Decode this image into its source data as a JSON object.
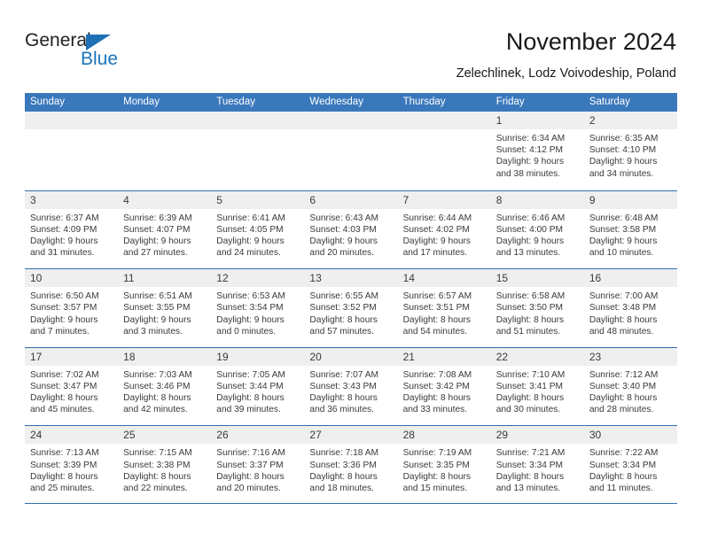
{
  "logo": {
    "word_one": "General",
    "word_two": "Blue",
    "triangle_color": "#1f6fb5",
    "blue_color": "#1b75bb"
  },
  "header": {
    "title": "November 2024",
    "location": "Zelechlinek, Lodz Voivodeship, Poland"
  },
  "colors": {
    "header_bar": "#3a78bc",
    "row_divider": "#2f6fb0",
    "daynum_band": "#efefef"
  },
  "weekdays": [
    "Sunday",
    "Monday",
    "Tuesday",
    "Wednesday",
    "Thursday",
    "Friday",
    "Saturday"
  ],
  "weeks": [
    [
      {
        "day": "",
        "sunrise": "",
        "sunset": "",
        "daylight1": "",
        "daylight2": ""
      },
      {
        "day": "",
        "sunrise": "",
        "sunset": "",
        "daylight1": "",
        "daylight2": ""
      },
      {
        "day": "",
        "sunrise": "",
        "sunset": "",
        "daylight1": "",
        "daylight2": ""
      },
      {
        "day": "",
        "sunrise": "",
        "sunset": "",
        "daylight1": "",
        "daylight2": ""
      },
      {
        "day": "",
        "sunrise": "",
        "sunset": "",
        "daylight1": "",
        "daylight2": ""
      },
      {
        "day": "1",
        "sunrise": "Sunrise: 6:34 AM",
        "sunset": "Sunset: 4:12 PM",
        "daylight1": "Daylight: 9 hours",
        "daylight2": "and 38 minutes."
      },
      {
        "day": "2",
        "sunrise": "Sunrise: 6:35 AM",
        "sunset": "Sunset: 4:10 PM",
        "daylight1": "Daylight: 9 hours",
        "daylight2": "and 34 minutes."
      }
    ],
    [
      {
        "day": "3",
        "sunrise": "Sunrise: 6:37 AM",
        "sunset": "Sunset: 4:09 PM",
        "daylight1": "Daylight: 9 hours",
        "daylight2": "and 31 minutes."
      },
      {
        "day": "4",
        "sunrise": "Sunrise: 6:39 AM",
        "sunset": "Sunset: 4:07 PM",
        "daylight1": "Daylight: 9 hours",
        "daylight2": "and 27 minutes."
      },
      {
        "day": "5",
        "sunrise": "Sunrise: 6:41 AM",
        "sunset": "Sunset: 4:05 PM",
        "daylight1": "Daylight: 9 hours",
        "daylight2": "and 24 minutes."
      },
      {
        "day": "6",
        "sunrise": "Sunrise: 6:43 AM",
        "sunset": "Sunset: 4:03 PM",
        "daylight1": "Daylight: 9 hours",
        "daylight2": "and 20 minutes."
      },
      {
        "day": "7",
        "sunrise": "Sunrise: 6:44 AM",
        "sunset": "Sunset: 4:02 PM",
        "daylight1": "Daylight: 9 hours",
        "daylight2": "and 17 minutes."
      },
      {
        "day": "8",
        "sunrise": "Sunrise: 6:46 AM",
        "sunset": "Sunset: 4:00 PM",
        "daylight1": "Daylight: 9 hours",
        "daylight2": "and 13 minutes."
      },
      {
        "day": "9",
        "sunrise": "Sunrise: 6:48 AM",
        "sunset": "Sunset: 3:58 PM",
        "daylight1": "Daylight: 9 hours",
        "daylight2": "and 10 minutes."
      }
    ],
    [
      {
        "day": "10",
        "sunrise": "Sunrise: 6:50 AM",
        "sunset": "Sunset: 3:57 PM",
        "daylight1": "Daylight: 9 hours",
        "daylight2": "and 7 minutes."
      },
      {
        "day": "11",
        "sunrise": "Sunrise: 6:51 AM",
        "sunset": "Sunset: 3:55 PM",
        "daylight1": "Daylight: 9 hours",
        "daylight2": "and 3 minutes."
      },
      {
        "day": "12",
        "sunrise": "Sunrise: 6:53 AM",
        "sunset": "Sunset: 3:54 PM",
        "daylight1": "Daylight: 9 hours",
        "daylight2": "and 0 minutes."
      },
      {
        "day": "13",
        "sunrise": "Sunrise: 6:55 AM",
        "sunset": "Sunset: 3:52 PM",
        "daylight1": "Daylight: 8 hours",
        "daylight2": "and 57 minutes."
      },
      {
        "day": "14",
        "sunrise": "Sunrise: 6:57 AM",
        "sunset": "Sunset: 3:51 PM",
        "daylight1": "Daylight: 8 hours",
        "daylight2": "and 54 minutes."
      },
      {
        "day": "15",
        "sunrise": "Sunrise: 6:58 AM",
        "sunset": "Sunset: 3:50 PM",
        "daylight1": "Daylight: 8 hours",
        "daylight2": "and 51 minutes."
      },
      {
        "day": "16",
        "sunrise": "Sunrise: 7:00 AM",
        "sunset": "Sunset: 3:48 PM",
        "daylight1": "Daylight: 8 hours",
        "daylight2": "and 48 minutes."
      }
    ],
    [
      {
        "day": "17",
        "sunrise": "Sunrise: 7:02 AM",
        "sunset": "Sunset: 3:47 PM",
        "daylight1": "Daylight: 8 hours",
        "daylight2": "and 45 minutes."
      },
      {
        "day": "18",
        "sunrise": "Sunrise: 7:03 AM",
        "sunset": "Sunset: 3:46 PM",
        "daylight1": "Daylight: 8 hours",
        "daylight2": "and 42 minutes."
      },
      {
        "day": "19",
        "sunrise": "Sunrise: 7:05 AM",
        "sunset": "Sunset: 3:44 PM",
        "daylight1": "Daylight: 8 hours",
        "daylight2": "and 39 minutes."
      },
      {
        "day": "20",
        "sunrise": "Sunrise: 7:07 AM",
        "sunset": "Sunset: 3:43 PM",
        "daylight1": "Daylight: 8 hours",
        "daylight2": "and 36 minutes."
      },
      {
        "day": "21",
        "sunrise": "Sunrise: 7:08 AM",
        "sunset": "Sunset: 3:42 PM",
        "daylight1": "Daylight: 8 hours",
        "daylight2": "and 33 minutes."
      },
      {
        "day": "22",
        "sunrise": "Sunrise: 7:10 AM",
        "sunset": "Sunset: 3:41 PM",
        "daylight1": "Daylight: 8 hours",
        "daylight2": "and 30 minutes."
      },
      {
        "day": "23",
        "sunrise": "Sunrise: 7:12 AM",
        "sunset": "Sunset: 3:40 PM",
        "daylight1": "Daylight: 8 hours",
        "daylight2": "and 28 minutes."
      }
    ],
    [
      {
        "day": "24",
        "sunrise": "Sunrise: 7:13 AM",
        "sunset": "Sunset: 3:39 PM",
        "daylight1": "Daylight: 8 hours",
        "daylight2": "and 25 minutes."
      },
      {
        "day": "25",
        "sunrise": "Sunrise: 7:15 AM",
        "sunset": "Sunset: 3:38 PM",
        "daylight1": "Daylight: 8 hours",
        "daylight2": "and 22 minutes."
      },
      {
        "day": "26",
        "sunrise": "Sunrise: 7:16 AM",
        "sunset": "Sunset: 3:37 PM",
        "daylight1": "Daylight: 8 hours",
        "daylight2": "and 20 minutes."
      },
      {
        "day": "27",
        "sunrise": "Sunrise: 7:18 AM",
        "sunset": "Sunset: 3:36 PM",
        "daylight1": "Daylight: 8 hours",
        "daylight2": "and 18 minutes."
      },
      {
        "day": "28",
        "sunrise": "Sunrise: 7:19 AM",
        "sunset": "Sunset: 3:35 PM",
        "daylight1": "Daylight: 8 hours",
        "daylight2": "and 15 minutes."
      },
      {
        "day": "29",
        "sunrise": "Sunrise: 7:21 AM",
        "sunset": "Sunset: 3:34 PM",
        "daylight1": "Daylight: 8 hours",
        "daylight2": "and 13 minutes."
      },
      {
        "day": "30",
        "sunrise": "Sunrise: 7:22 AM",
        "sunset": "Sunset: 3:34 PM",
        "daylight1": "Daylight: 8 hours",
        "daylight2": "and 11 minutes."
      }
    ]
  ]
}
